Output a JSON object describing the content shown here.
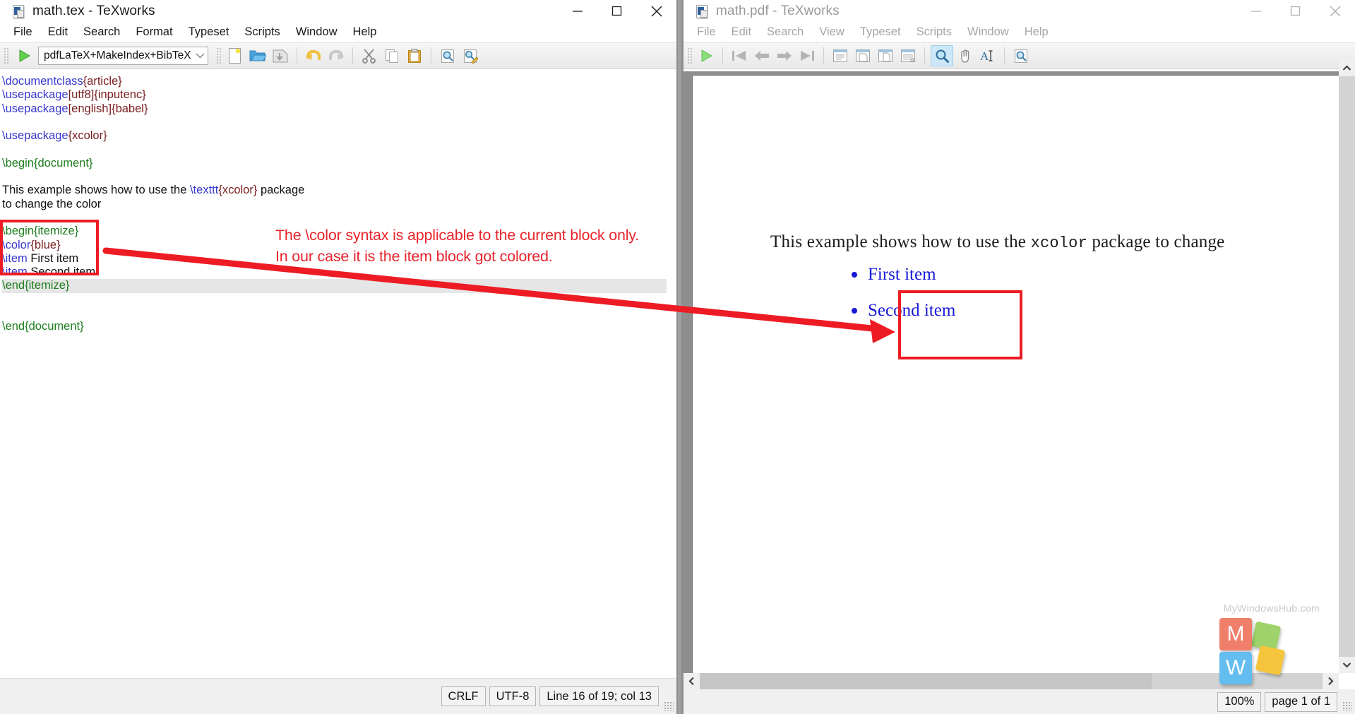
{
  "editor_window": {
    "title": "math.tex - TeXworks",
    "icon": "tex-document-icon",
    "window_controls": {
      "minimize": "minimize-icon",
      "maximize": "maximize-icon",
      "close": "close-icon"
    },
    "menus": [
      "File",
      "Edit",
      "Search",
      "Format",
      "Typeset",
      "Scripts",
      "Window",
      "Help"
    ],
    "toolbar": {
      "run_label": "run-typeset-button",
      "typeset_engine": "pdfLaTeX+MakeIndex+BibTeX",
      "buttons": [
        "new-file-icon",
        "open-file-icon",
        "save-file-icon",
        "undo-icon",
        "redo-icon",
        "cut-icon",
        "copy-icon",
        "paste-icon",
        "find-icon",
        "find-replace-icon"
      ]
    },
    "source_lines": [
      {
        "id": "l1",
        "current": false,
        "tokens": [
          {
            "t": "\\documentclass",
            "c": "cmd"
          },
          {
            "t": "{",
            "c": "brace"
          },
          {
            "t": "article",
            "c": "arg"
          },
          {
            "t": "}",
            "c": "brace"
          }
        ]
      },
      {
        "id": "l2",
        "current": false,
        "tokens": [
          {
            "t": "\\usepackage",
            "c": "cmd"
          },
          {
            "t": "[",
            "c": "brace"
          },
          {
            "t": "utf8",
            "c": "arg"
          },
          {
            "t": "]",
            "c": "brace"
          },
          {
            "t": "{",
            "c": "brace"
          },
          {
            "t": "inputenc",
            "c": "arg"
          },
          {
            "t": "}",
            "c": "brace"
          }
        ]
      },
      {
        "id": "l3",
        "current": false,
        "tokens": [
          {
            "t": "\\usepackage",
            "c": "cmd"
          },
          {
            "t": "[",
            "c": "brace"
          },
          {
            "t": "english",
            "c": "arg"
          },
          {
            "t": "]",
            "c": "brace"
          },
          {
            "t": "{",
            "c": "brace"
          },
          {
            "t": "babel",
            "c": "arg"
          },
          {
            "t": "}",
            "c": "brace"
          }
        ]
      },
      {
        "id": "l4",
        "current": false,
        "tokens": []
      },
      {
        "id": "l5",
        "current": false,
        "tokens": [
          {
            "t": "\\usepackage",
            "c": "cmd"
          },
          {
            "t": "{",
            "c": "brace"
          },
          {
            "t": "xcolor",
            "c": "arg"
          },
          {
            "t": "}",
            "c": "brace"
          }
        ]
      },
      {
        "id": "l6",
        "current": false,
        "tokens": []
      },
      {
        "id": "l7",
        "current": false,
        "tokens": [
          {
            "t": "\\begin{document}",
            "c": "env"
          }
        ]
      },
      {
        "id": "l8",
        "current": false,
        "tokens": []
      },
      {
        "id": "l9",
        "current": false,
        "tokens": [
          {
            "t": "This example shows how to use the ",
            "c": "txt"
          },
          {
            "t": "\\texttt",
            "c": "cmd"
          },
          {
            "t": "{",
            "c": "brace"
          },
          {
            "t": "xcolor",
            "c": "arg"
          },
          {
            "t": "}",
            "c": "brace"
          },
          {
            "t": " package",
            "c": "txt"
          }
        ]
      },
      {
        "id": "l10",
        "current": false,
        "tokens": [
          {
            "t": "to change the color",
            "c": "txt"
          }
        ]
      },
      {
        "id": "l11",
        "current": false,
        "tokens": []
      },
      {
        "id": "l12",
        "current": false,
        "tokens": [
          {
            "t": "\\begin{itemize}",
            "c": "env"
          }
        ]
      },
      {
        "id": "l13",
        "current": false,
        "tokens": [
          {
            "t": "\\color",
            "c": "cmd"
          },
          {
            "t": "{",
            "c": "brace"
          },
          {
            "t": "blue",
            "c": "arg"
          },
          {
            "t": "}",
            "c": "brace"
          }
        ]
      },
      {
        "id": "l14",
        "current": false,
        "tokens": [
          {
            "t": "\\item",
            "c": "cmd"
          },
          {
            "t": " First item",
            "c": "txt"
          }
        ]
      },
      {
        "id": "l15",
        "current": false,
        "tokens": [
          {
            "t": "\\item",
            "c": "cmd"
          },
          {
            "t": " Second item",
            "c": "txt"
          }
        ]
      },
      {
        "id": "l16",
        "current": true,
        "tokens": [
          {
            "t": "\\end{itemize}",
            "c": "env"
          }
        ]
      },
      {
        "id": "l17",
        "current": false,
        "tokens": []
      },
      {
        "id": "l18",
        "current": false,
        "tokens": []
      },
      {
        "id": "l19",
        "current": false,
        "tokens": [
          {
            "t": "\\end{document}",
            "c": "env"
          }
        ]
      }
    ],
    "statusbar": {
      "line_ending": "CRLF",
      "encoding": "UTF-8",
      "position": "Line 16 of 19; col 13"
    }
  },
  "pdf_window": {
    "title": "math.pdf - TeXworks",
    "icon": "pdf-document-icon",
    "active": false,
    "window_controls": {
      "minimize": "minimize-icon",
      "maximize": "maximize-icon",
      "close": "close-icon"
    },
    "menus": [
      "File",
      "Edit",
      "Search",
      "View",
      "Typeset",
      "Scripts",
      "Window",
      "Help"
    ],
    "toolbar": {
      "buttons": [
        "run-typeset-icon",
        "first-page-icon",
        "previous-page-icon",
        "next-page-icon",
        "last-page-icon",
        "fit-width-icon",
        "fit-window-icon",
        "actual-size-icon",
        "fit-content-icon",
        "magnifier-tool-icon",
        "pan-tool-icon",
        "text-select-tool-icon",
        "search-pdf-icon"
      ],
      "active_tool": "magnifier-tool-icon"
    },
    "page": {
      "paragraph_prefix": "This example shows how to use the ",
      "paragraph_mono": "xcolor",
      "paragraph_suffix": " package to change",
      "items": [
        "First item",
        "Second item"
      ]
    },
    "statusbar": {
      "zoom": "100%",
      "page": "page 1 of 1"
    }
  },
  "annotation": {
    "color": "#ed1c24",
    "text_line1": "The \\color syntax is applicable to the current block only.",
    "text_line2": "In our case it is the item block got colored.",
    "source_highlight": "itemize-block-source-box",
    "output_highlight": "itemize-block-output-box",
    "arrow": "source-to-output-arrow"
  },
  "watermark": {
    "text": "MyWindowsHub.com",
    "tile_m": "M",
    "tile_w": "W"
  }
}
